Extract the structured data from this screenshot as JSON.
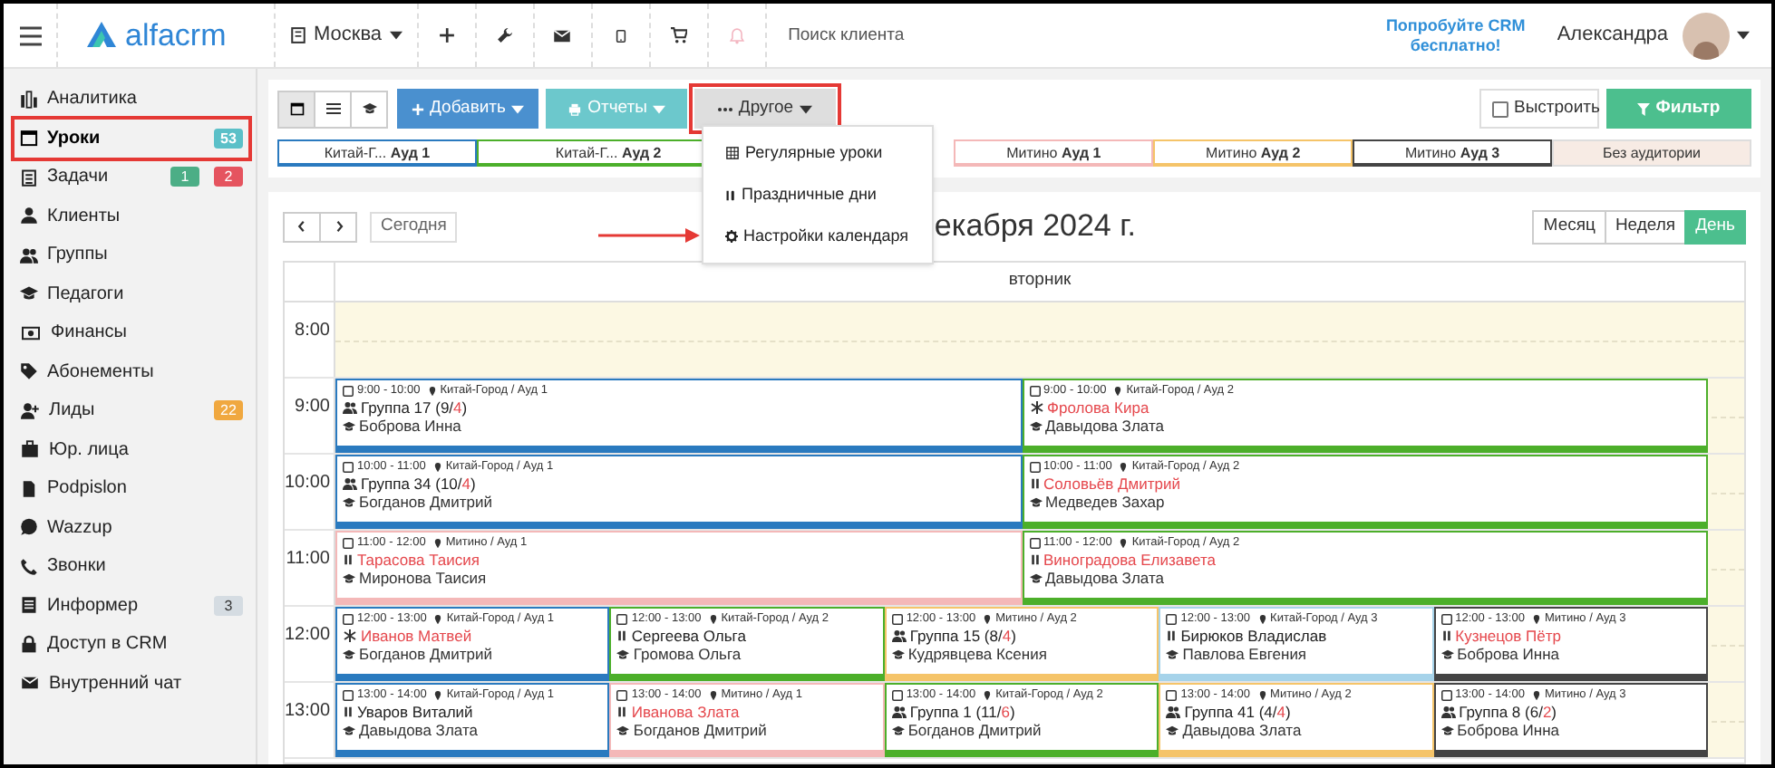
{
  "topbar": {
    "logo": "alfacrm",
    "city": "Москва",
    "search": {
      "placeholder": "Поиск клиента"
    },
    "promo": "Попробуйте CRM бесплатно!",
    "user": "Александра",
    "notifications_disabled": true
  },
  "sidebar": {
    "items": [
      {
        "label": "Аналитика",
        "selected": false
      },
      {
        "label": "Уроки",
        "selected": true,
        "highlighted": true,
        "badges": [
          {
            "text": "53",
            "color": "#5bc0c8"
          }
        ]
      },
      {
        "label": "Задачи",
        "selected": false,
        "badges": [
          {
            "text": "1",
            "color": "#4cae86"
          },
          {
            "text": "2",
            "color": "#e5545f"
          }
        ]
      },
      {
        "label": "Клиенты",
        "selected": false
      },
      {
        "label": "Группы",
        "selected": false
      },
      {
        "label": "Педагоги",
        "selected": false
      },
      {
        "label": "Финансы",
        "selected": false
      },
      {
        "label": "Абонементы",
        "selected": false
      },
      {
        "label": "Лиды",
        "selected": false,
        "badges": [
          {
            "text": "22",
            "color": "#f0a840"
          }
        ]
      },
      {
        "label": "Юр. лица",
        "selected": false
      },
      {
        "label": "Podpislon",
        "selected": false
      },
      {
        "label": "Wazzup",
        "selected": false
      },
      {
        "label": "Звонки",
        "selected": false
      },
      {
        "label": "Информер",
        "selected": false,
        "badges": [
          {
            "text": "3",
            "color": "#d5dce2"
          }
        ]
      },
      {
        "label": "Доступ в CRM",
        "selected": false
      },
      {
        "label": "Внутренний чат",
        "selected": false
      }
    ]
  },
  "toolbar": {
    "views": [
      {
        "selected": true
      },
      {
        "selected": false
      },
      {
        "selected": false
      }
    ],
    "buttons": [
      {
        "label": "Добавить",
        "color": "#4a90cf",
        "highlighted": false
      },
      {
        "label": "Отчеты",
        "color": "#6cc8cc",
        "highlighted": false
      },
      {
        "label": "Другое",
        "color": "#dedede",
        "highlighted": true
      }
    ],
    "align": {
      "label": "Выстроить",
      "checked": false
    },
    "filter": "Фильтр",
    "rooms": [
      {
        "label": "Китай-Г... **Ауд 1**",
        "color": "#2a7abf"
      },
      {
        "label": "Китай-Г... **Ауд 2**",
        "color": "#4caf2a"
      },
      {
        "label": "Митино **Ауд 1**",
        "color": "#f4b8b8"
      },
      {
        "label": "Митино **Ауд 2**",
        "color": "#f5c469"
      },
      {
        "label": "Митино **Ауд 3**",
        "color": "#444444"
      },
      {
        "label": "Без аудитории",
        "color": "#f7ebe4"
      }
    ]
  },
  "dropdown": {
    "items": [
      "Регулярные уроки",
      "Праздничные дни",
      "Настройки календаря"
    ]
  },
  "calendar": {
    "today": "Сегодня",
    "title": "екабря 2024 г.",
    "views": [
      {
        "label": "Месяц",
        "selected": false
      },
      {
        "label": "Неделя",
        "selected": false
      },
      {
        "label": "День",
        "selected": true
      }
    ],
    "day": "вторник",
    "hours": [
      {
        "time": "8:00"
      },
      {
        "time": "9:00",
        "lessons": [
          {
            "kind": "group",
            "time": "9:00 - 10:00",
            "place": "Китай-Город / Ауд 1",
            "color": "#2a7abf",
            "parts": [
              {
                "text": "Группа 17 (9/",
                "alert": false
              },
              {
                "text": "4",
                "alert": true
              },
              {
                "text": ")",
                "alert": false
              }
            ],
            "teacher": "Боброва Инна"
          },
          {
            "kind": "trial",
            "time": "9:00 - 10:00",
            "place": "Китай-Город / Ауд 2",
            "color": "#4caf2a",
            "parts": [
              {
                "text": "Фролова Кира",
                "alert": true
              }
            ],
            "teacher": "Давыдова Злата"
          }
        ]
      },
      {
        "time": "10:00",
        "lessons": [
          {
            "kind": "group",
            "time": "10:00 - 11:00",
            "place": "Китай-Город / Ауд 1",
            "color": "#2a7abf",
            "parts": [
              {
                "text": "Группа 34 (10/",
                "alert": false
              },
              {
                "text": "4",
                "alert": true
              },
              {
                "text": ")",
                "alert": false
              }
            ],
            "teacher": "Богданов Дмитрий"
          },
          {
            "kind": "individual",
            "time": "10:00 - 11:00",
            "place": "Китай-Город / Ауд 2",
            "color": "#4caf2a",
            "parts": [
              {
                "text": "Соловьёв Дмитрий",
                "alert": true
              }
            ],
            "teacher": "Медведев Захар"
          }
        ]
      },
      {
        "time": "11:00",
        "lessons": [
          {
            "kind": "individual",
            "time": "11:00 - 12:00",
            "place": "Митино / Ауд 1",
            "color": "#f4b8b8",
            "parts": [
              {
                "text": "Тарасова Таисия",
                "alert": true
              }
            ],
            "teacher": "Миронова Таисия"
          },
          {
            "kind": "individual",
            "time": "11:00 - 12:00",
            "place": "Китай-Город / Ауд 2",
            "color": "#4caf2a",
            "parts": [
              {
                "text": "Виноградова Елизавета",
                "alert": true
              }
            ],
            "teacher": "Давыдова Злата"
          }
        ]
      },
      {
        "time": "12:00",
        "lessons": [
          {
            "kind": "trial",
            "time": "12:00 - 13:00",
            "place": "Китай-Город / Ауд 1",
            "color": "#2a7abf",
            "parts": [
              {
                "text": "Иванов Матвей",
                "alert": true
              }
            ],
            "teacher": "Богданов Дмитрий"
          },
          {
            "kind": "individual",
            "time": "12:00 - 13:00",
            "place": "Китай-Город / Ауд 2",
            "color": "#4caf2a",
            "parts": [
              {
                "text": "Сергеева Ольга",
                "alert": false
              }
            ],
            "teacher": "Громова Ольга"
          },
          {
            "kind": "group",
            "time": "12:00 - 13:00",
            "place": "Митино / Ауд 2",
            "color": "#f5c469",
            "parts": [
              {
                "text": "Группа 15 (8/",
                "alert": false
              },
              {
                "text": "4",
                "alert": true
              },
              {
                "text": ")",
                "alert": false
              }
            ],
            "teacher": "Кудрявцева Ксения"
          },
          {
            "kind": "individual",
            "time": "12:00 - 13:00",
            "place": "Китай-Город / Ауд 3",
            "color": "#a6d3ea",
            "parts": [
              {
                "text": "Бирюков Владислав",
                "alert": false
              }
            ],
            "teacher": "Павлова Евгения"
          },
          {
            "kind": "individual",
            "time": "12:00 - 13:00",
            "place": "Митино / Ауд 3",
            "color": "#444444",
            "parts": [
              {
                "text": "Кузнецов Пётр",
                "alert": true
              }
            ],
            "teacher": "Боброва Инна"
          }
        ]
      },
      {
        "time": "13:00",
        "lessons": [
          {
            "kind": "individual",
            "time": "13:00 - 14:00",
            "place": "Китай-Город / Ауд 1",
            "color": "#2a7abf",
            "parts": [
              {
                "text": "Уваров Виталий",
                "alert": false
              }
            ],
            "teacher": "Давыдова Злата"
          },
          {
            "kind": "individual",
            "time": "13:00 - 14:00",
            "place": "Митино / Ауд 1",
            "color": "#f4b8b8",
            "parts": [
              {
                "text": "Иванова Злата",
                "alert": true
              }
            ],
            "teacher": "Богданов Дмитрий"
          },
          {
            "kind": "group",
            "time": "13:00 - 14:00",
            "place": "Китай-Город / Ауд 2",
            "color": "#4caf2a",
            "parts": [
              {
                "text": "Группа 1 (11/",
                "alert": false
              },
              {
                "text": "6",
                "alert": true
              },
              {
                "text": ")",
                "alert": false
              }
            ],
            "teacher": "Богданов Дмитрий"
          },
          {
            "kind": "group",
            "time": "13:00 - 14:00",
            "place": "Митино / Ауд 2",
            "color": "#f5c469",
            "parts": [
              {
                "text": "Группа 41 (4/",
                "alert": false
              },
              {
                "text": "4",
                "alert": true
              },
              {
                "text": ")",
                "alert": false
              }
            ],
            "teacher": "Давыдова Злата"
          },
          {
            "kind": "group",
            "time": "13:00 - 14:00",
            "place": "Митино / Ауд 3",
            "color": "#444444",
            "parts": [
              {
                "text": "Группа 8 (6/",
                "alert": false
              },
              {
                "text": "2",
                "alert": true
              },
              {
                "text": ")",
                "alert": false
              }
            ],
            "teacher": "Боброва Инна"
          }
        ]
      }
    ]
  }
}
